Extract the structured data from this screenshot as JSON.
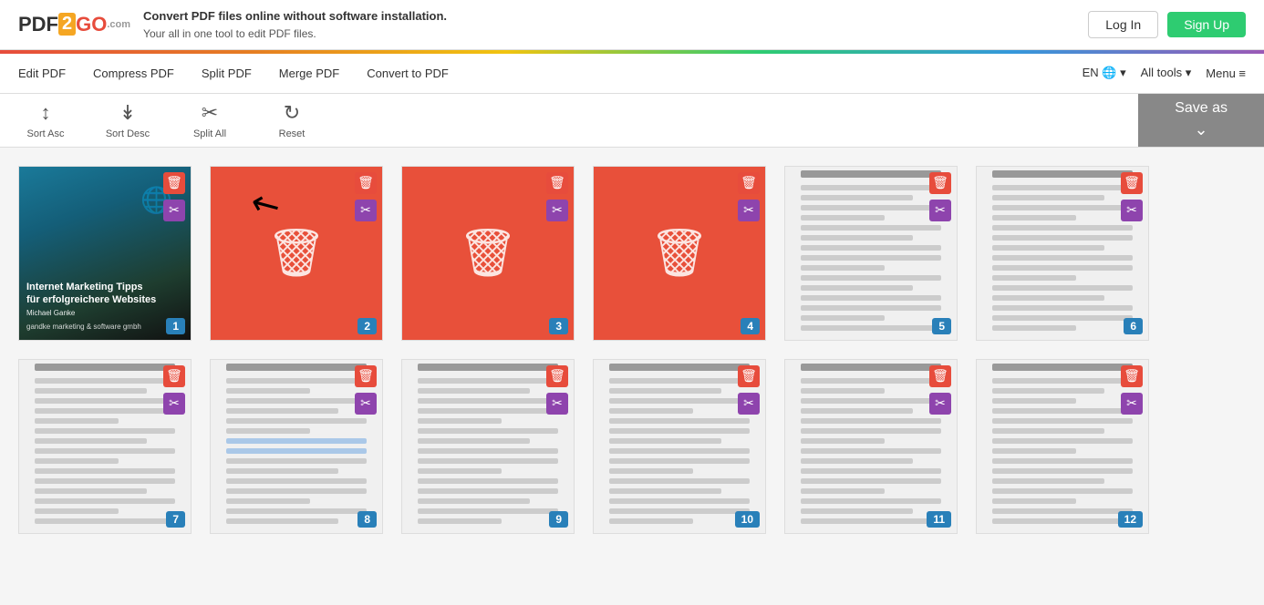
{
  "header": {
    "logo_pdf": "PDF",
    "logo_2": "2",
    "logo_go": "GO",
    "logo_com": ".com",
    "tagline_main": "Convert PDF files online without software installation.",
    "tagline_sub": "Your all in one tool to edit PDF files.",
    "btn_login": "Log In",
    "btn_signup": "Sign Up"
  },
  "nav": {
    "links": [
      {
        "label": "Edit PDF",
        "id": "edit-pdf"
      },
      {
        "label": "Compress PDF",
        "id": "compress-pdf"
      },
      {
        "label": "Split PDF",
        "id": "split-pdf"
      },
      {
        "label": "Merge PDF",
        "id": "merge-pdf"
      },
      {
        "label": "Convert to PDF",
        "id": "convert-pdf"
      }
    ],
    "right": [
      {
        "label": "EN 🌐 ▾"
      },
      {
        "label": "All tools ▾"
      },
      {
        "label": "Menu ≡"
      }
    ]
  },
  "toolbar": {
    "sort_asc_label": "Sort Asc",
    "sort_desc_label": "Sort Desc",
    "split_all_label": "Split All",
    "reset_label": "Reset",
    "save_as_label": "Save as"
  },
  "pages": [
    {
      "num": 1,
      "type": "cover"
    },
    {
      "num": 2,
      "type": "red"
    },
    {
      "num": 3,
      "type": "red"
    },
    {
      "num": 4,
      "type": "red"
    },
    {
      "num": 5,
      "type": "doc"
    },
    {
      "num": 6,
      "type": "doc"
    },
    {
      "num": 7,
      "type": "doc"
    },
    {
      "num": 8,
      "type": "doc"
    },
    {
      "num": 9,
      "type": "doc"
    },
    {
      "num": 10,
      "type": "doc"
    },
    {
      "num": 11,
      "type": "doc"
    },
    {
      "num": 12,
      "type": "doc"
    }
  ]
}
